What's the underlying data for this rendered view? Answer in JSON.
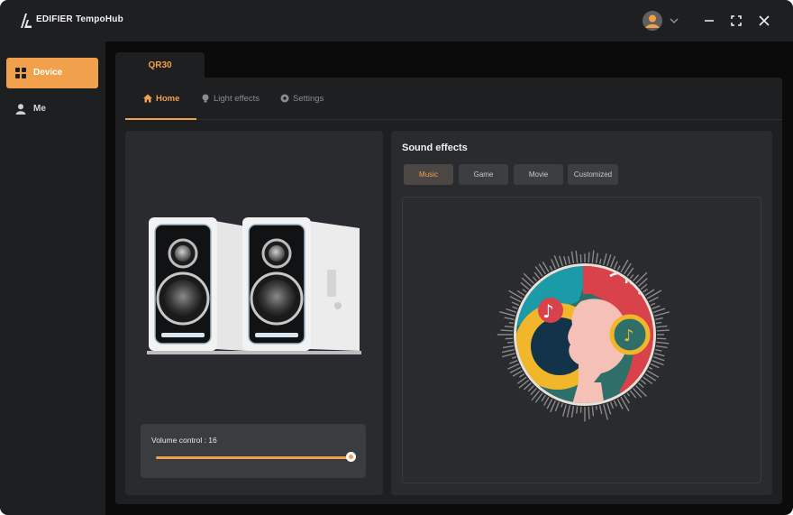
{
  "app": {
    "title": "EDIFIER TempoHub"
  },
  "colors": {
    "accent": "#f1a14c",
    "background": "#0b0b0c",
    "panel": "#1e1f21",
    "card": "#2a2b2e"
  },
  "titlebar": {
    "icons": [
      "edifier-logo-icon",
      "user-avatar-icon",
      "chevron-down-icon",
      "minimize-icon",
      "maximize-icon",
      "close-icon"
    ]
  },
  "sidebar": {
    "items": [
      {
        "label": "Device",
        "icon": "grid-icon",
        "active": true
      },
      {
        "label": "Me",
        "icon": "user-icon",
        "active": false
      }
    ]
  },
  "device_tab": {
    "label": "QR30"
  },
  "subtabs": [
    {
      "label": "Home",
      "icon": "home-icon",
      "active": true
    },
    {
      "label": "Light effects",
      "icon": "bulb-icon",
      "active": false
    },
    {
      "label": "Settings",
      "icon": "gear-icon",
      "active": false
    }
  ],
  "volume": {
    "label": "Volume control : 16",
    "value": 16,
    "fill_fraction": 1.0
  },
  "sound_effects": {
    "title": "Sound effects",
    "modes": [
      {
        "label": "Music",
        "active": true
      },
      {
        "label": "Game",
        "active": false
      },
      {
        "label": "Movie",
        "active": false
      },
      {
        "label": "Customized",
        "active": false
      }
    ]
  }
}
